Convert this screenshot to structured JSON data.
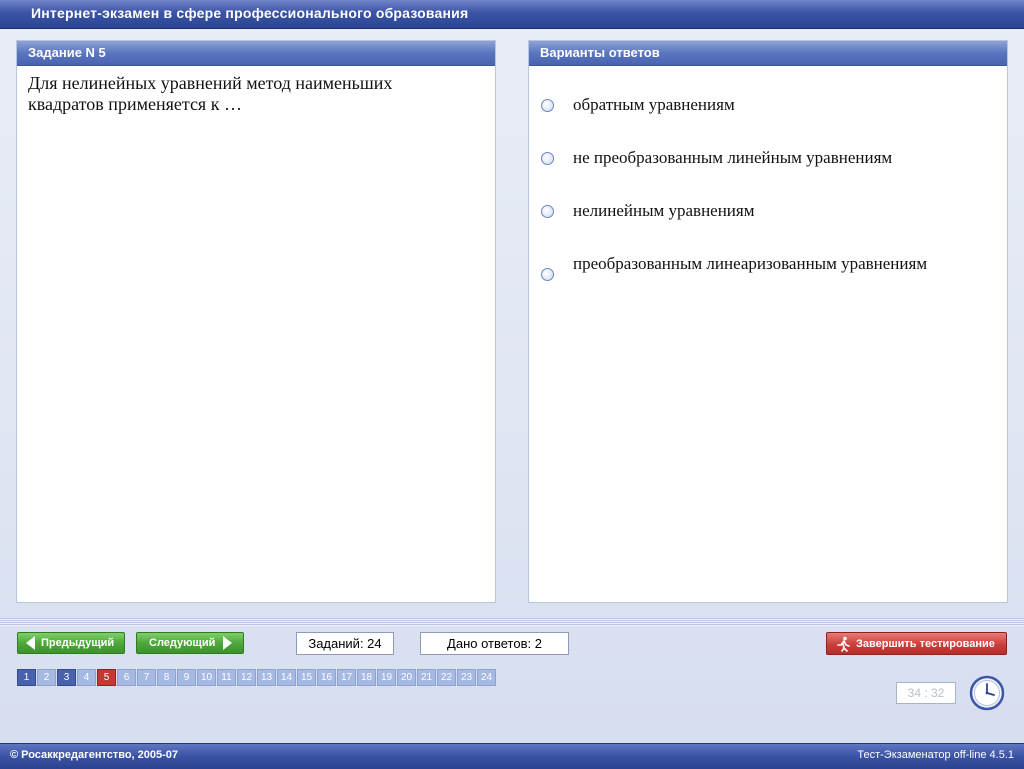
{
  "window": {
    "title": "Интернет-экзамен в сфере профессионального образования"
  },
  "question_panel": {
    "header": "Задание N 5",
    "text": "Для нелинейных уравнений метод наименьших квадратов применяется к …"
  },
  "answers_panel": {
    "header": "Варианты ответов",
    "options": [
      "обратным уравнениям",
      "не преобразованным линейным уравнениям",
      "нелинейным уравнениям",
      "преобразованным линеаризованным уравнениям"
    ]
  },
  "navigation": {
    "prev_label": "Предыдущий",
    "next_label": "Следующий",
    "finish_label": "Завершить тестирование"
  },
  "counters": {
    "tasks": "Заданий: 24",
    "answers_given": "Дано ответов: 2"
  },
  "pager": {
    "pages": [
      "1",
      "2",
      "3",
      "4",
      "5",
      "6",
      "7",
      "8",
      "9",
      "10",
      "11",
      "12",
      "13",
      "14",
      "15",
      "16",
      "17",
      "18",
      "19",
      "20",
      "21",
      "22",
      "23",
      "24"
    ],
    "answered": [
      "1",
      "3"
    ],
    "current": "5"
  },
  "timer": {
    "value": "34 : 32"
  },
  "footer": {
    "copyright": "© Росаккредагентство, 2005-07",
    "version": "Тест-Экзаменатор off-line 4.5.1"
  },
  "colors": {
    "title_bar": "#3c54a6",
    "panel_header": "#5b76bf",
    "nav_button": "#4ea83a",
    "finish_button": "#cc3f3a",
    "page_answered": "#4a62ae",
    "page_current": "#c23a33",
    "page_open": "#a6b9e2"
  },
  "icons": {
    "finish": "running-man-icon",
    "timer": "clock-icon",
    "prev": "arrow-left-icon",
    "next": "arrow-right-icon"
  }
}
